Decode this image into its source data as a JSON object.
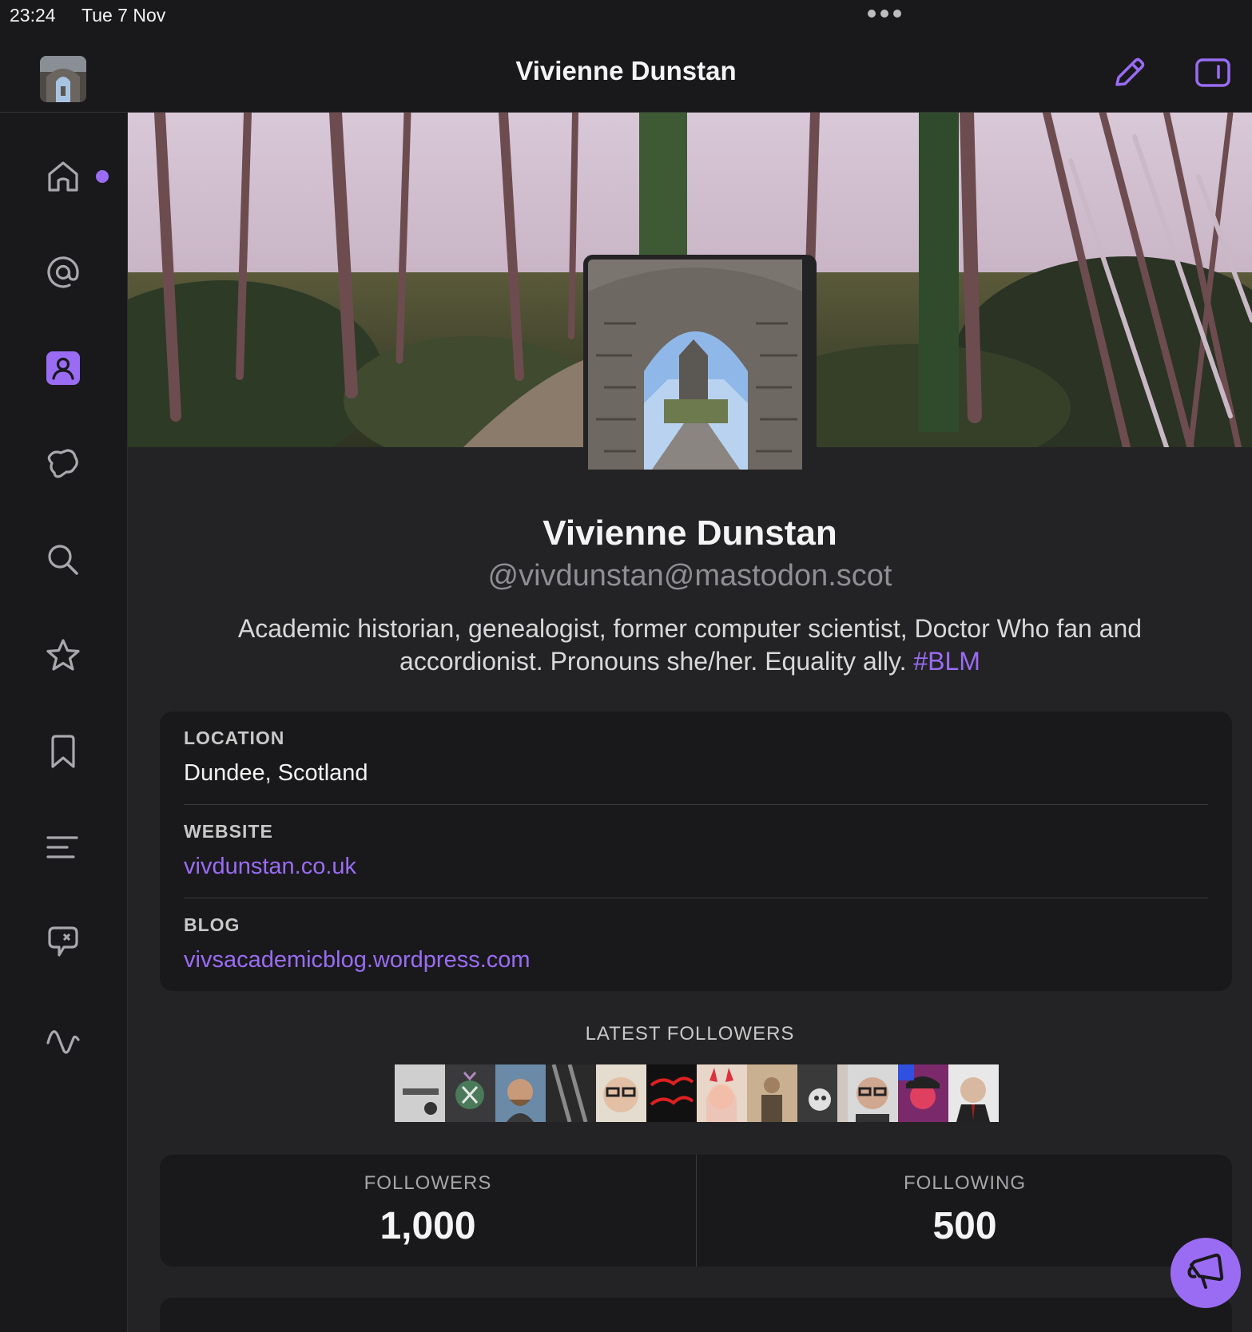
{
  "status_bar": {
    "time": "23:24",
    "date": "Tue 7 Nov"
  },
  "navbar": {
    "title": "Vivienne Dunstan"
  },
  "sidebar": {
    "items": [
      {
        "icon": "home-icon",
        "selected": false,
        "has_unread": true
      },
      {
        "icon": "mentions-icon",
        "selected": false
      },
      {
        "icon": "profile-icon",
        "selected": true
      },
      {
        "icon": "explore-icon",
        "selected": false
      },
      {
        "icon": "search-icon",
        "selected": false
      },
      {
        "icon": "favourites-icon",
        "selected": false
      },
      {
        "icon": "bookmarks-icon",
        "selected": false
      },
      {
        "icon": "lists-icon",
        "selected": false
      },
      {
        "icon": "direct-messages-icon",
        "selected": false
      },
      {
        "icon": "activity-icon",
        "selected": false
      }
    ]
  },
  "profile": {
    "display_name": "Vivienne Dunstan",
    "handle": "@vivdunstan@mastodon.scot",
    "bio": "Academic historian, genealogist, former computer scientist, Doctor Who fan and accordionist. Pronouns she/her. Equality ally.",
    "bio_hashtag": "#BLM",
    "fields": [
      {
        "label": "LOCATION",
        "value": "Dundee, Scotland",
        "is_link": false
      },
      {
        "label": "WEBSITE",
        "value": "vivdunstan.co.uk",
        "is_link": true
      },
      {
        "label": "BLOG",
        "value": "vivsacademicblog.wordpress.com",
        "is_link": true
      }
    ],
    "latest_followers_title": "LATEST FOLLOWERS",
    "stats": {
      "followers_label": "FOLLOWERS",
      "followers_count": "1,000",
      "following_label": "FOLLOWING",
      "following_count": "500"
    }
  },
  "colors": {
    "accent": "#9a6cf4",
    "background": "#232325",
    "card": "#19191b",
    "secondary_text": "#8e8e93"
  }
}
